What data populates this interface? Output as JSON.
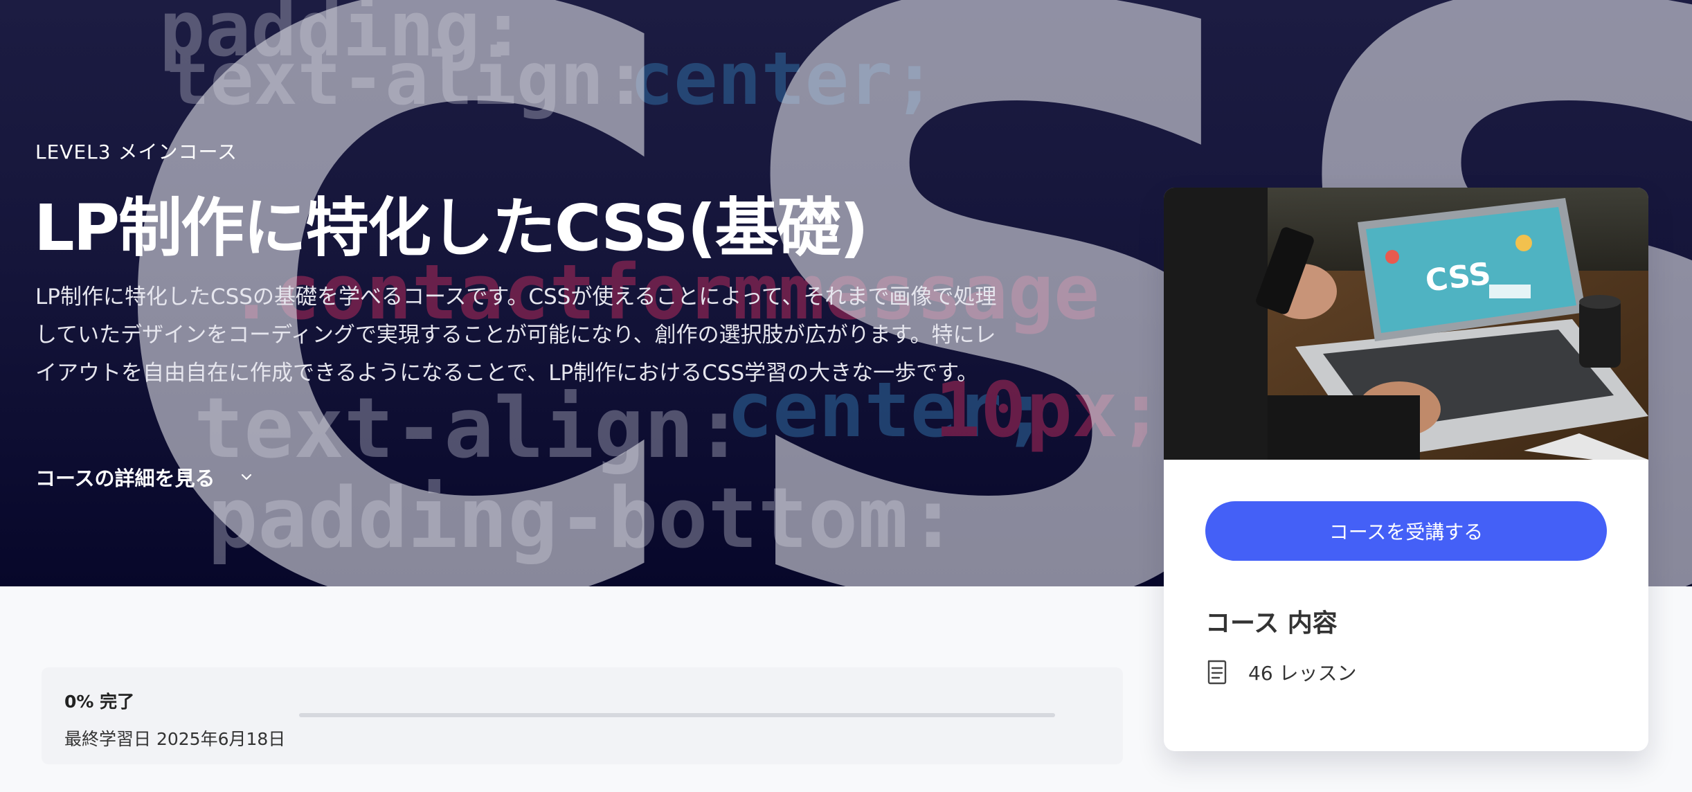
{
  "hero": {
    "eyebrow": "LEVEL3 メインコース",
    "title": "LP制作に特化したCSS(基礎)",
    "description": "LP制作に特化したCSSの基礎を学べるコースです。CSSが使えることによって、それまで画像で処理していたデザインをコーディングで実現することが可能になり、創作の選択肢が広がります。特にレイアウトを自由自在に作成できるようになることで、LP制作におけるCSS学習の大きな一歩です。",
    "details_link": "コースの詳細を見る",
    "details_icon": "chevron-down-icon"
  },
  "progress": {
    "percent_label": "0% 完了",
    "percent": 0,
    "last_studied": "最終学習日 2025年6月18日"
  },
  "course_card": {
    "enroll_button": "コースを受講する",
    "contents_heading": "コース 内容",
    "lessons_icon": "book-icon",
    "lessons": "46 レッスン"
  },
  "colors": {
    "accent": "#4460f7",
    "hero_bg": "#15153a"
  }
}
